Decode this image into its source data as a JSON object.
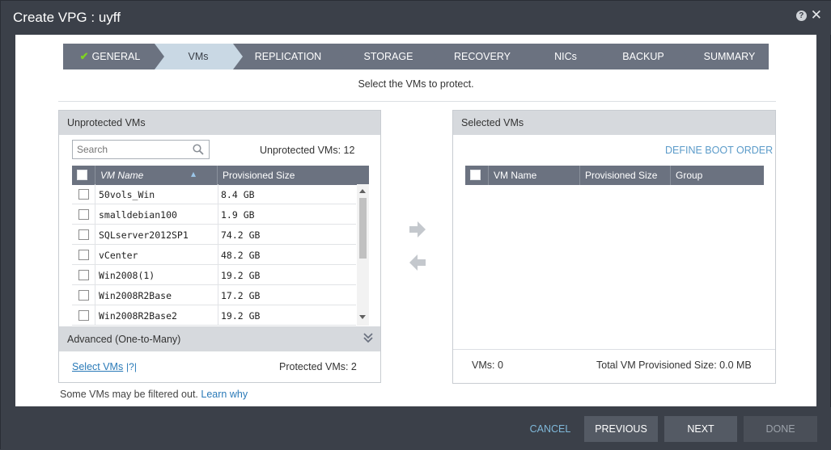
{
  "window": {
    "title": "Create VPG : uyff",
    "help_icon": "help-icon",
    "close_icon": "close-icon"
  },
  "steps": [
    {
      "label": "GENERAL",
      "state": "done"
    },
    {
      "label": "VMs",
      "state": "active"
    },
    {
      "label": "REPLICATION",
      "state": "todo"
    },
    {
      "label": "STORAGE",
      "state": "todo"
    },
    {
      "label": "RECOVERY",
      "state": "todo"
    },
    {
      "label": "NICs",
      "state": "todo"
    },
    {
      "label": "BACKUP",
      "state": "todo"
    },
    {
      "label": "SUMMARY",
      "state": "todo"
    }
  ],
  "subtitle": "Select the VMs to protect.",
  "left_panel": {
    "header": "Unprotected VMs",
    "search_placeholder": "Search",
    "count_label": "Unprotected VMs: 12",
    "columns": [
      "VM Name",
      "Provisioned Size"
    ],
    "rows": [
      {
        "name": "50vols_Win",
        "size": "8.4 GB"
      },
      {
        "name": "smalldebian100",
        "size": "1.9 GB"
      },
      {
        "name": "SQLserver2012SP1",
        "size": "74.2 GB"
      },
      {
        "name": "vCenter",
        "size": "48.2 GB"
      },
      {
        "name": "Win2008(1)",
        "size": "19.2 GB"
      },
      {
        "name": "Win2008R2Base",
        "size": "17.2 GB"
      },
      {
        "name": "Win2008R2Base2",
        "size": "19.2 GB"
      }
    ],
    "advanced_label": "Advanced (One-to-Many)",
    "select_vms_link": "Select VMs",
    "help_link": "?",
    "protected_count": "Protected VMs: 2"
  },
  "filter_note": {
    "text": "Some VMs may be filtered out.",
    "link": "Learn why"
  },
  "right_panel": {
    "header": "Selected VMs",
    "define_boot_order": "DEFINE BOOT ORDER",
    "columns": [
      "VM Name",
      "Provisioned Size",
      "Group"
    ],
    "vms_count": "VMs: 0",
    "total_size": "Total VM Provisioned Size: 0.0 MB"
  },
  "footer": {
    "cancel": "CANCEL",
    "previous": "PREVIOUS",
    "next": "NEXT",
    "done": "DONE"
  },
  "colors": {
    "step_done": "#6b7280",
    "step_active": "#c9d8e4",
    "step_todo": "#6b7280",
    "accent_link": "#2a7ab8",
    "check": "#7ed321"
  }
}
